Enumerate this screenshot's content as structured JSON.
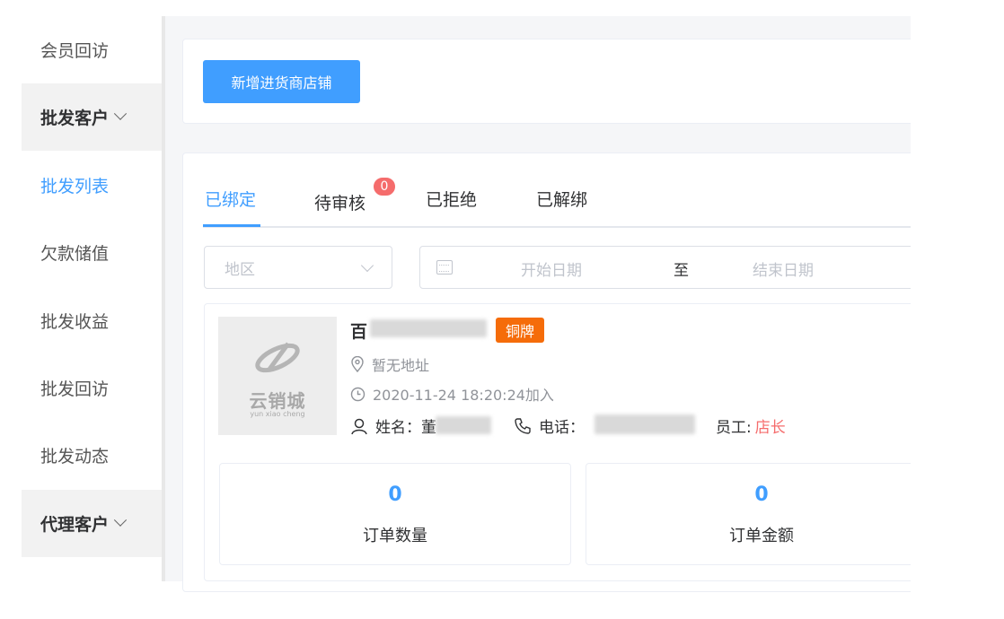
{
  "sidebar": {
    "items": [
      {
        "label": "会员回访"
      },
      {
        "label": "批发客户"
      },
      {
        "label": "批发列表"
      },
      {
        "label": "欠款储值"
      },
      {
        "label": "批发收益"
      },
      {
        "label": "批发回访"
      },
      {
        "label": "批发动态"
      },
      {
        "label": "代理客户"
      }
    ]
  },
  "toolbar": {
    "add_label": "新增进货商店铺"
  },
  "tabs": [
    {
      "label": "已绑定"
    },
    {
      "label": "待审核",
      "badge": "0"
    },
    {
      "label": "已拒绝"
    },
    {
      "label": "已解绑"
    }
  ],
  "filters": {
    "region_placeholder": "地区",
    "start_placeholder": "开始日期",
    "separator": "至",
    "end_placeholder": "结束日期"
  },
  "shop": {
    "name_visible": "百",
    "level": "铜牌",
    "address": "暂无地址",
    "joined": "2020-11-24 18:20:24加入",
    "name_label": "姓名：",
    "name_visible_char": "董",
    "phone_label": "电话：",
    "staff_label": "员工:",
    "staff_value": "店长",
    "logo_text": "云销城",
    "logo_sub": "yun xiao cheng"
  },
  "stats": [
    {
      "value": "0",
      "label": "订单数量"
    },
    {
      "value": "0",
      "label": "订单金额"
    }
  ],
  "colors": {
    "accent": "#409eff",
    "badge": "#f56c6c",
    "tag": "#f56c0a"
  }
}
